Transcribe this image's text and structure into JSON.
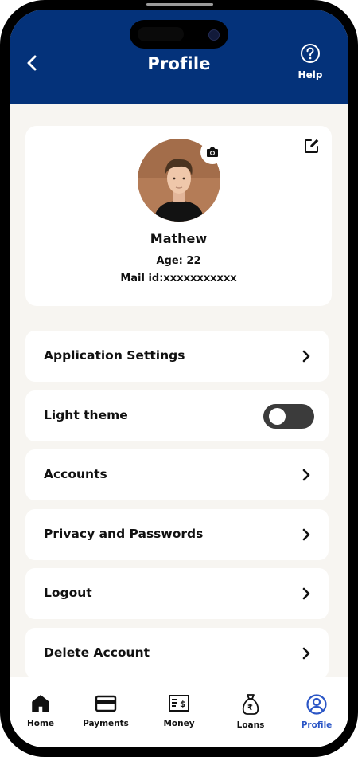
{
  "header": {
    "title": "Profile",
    "help_label": "Help",
    "background_color": "#04327a"
  },
  "profile": {
    "name": "Mathew",
    "age": "Age: 22",
    "mail": "Mail id:xxxxxxxxxxx"
  },
  "menu": [
    {
      "label": "Application Settings",
      "control": "chevron"
    },
    {
      "label": "Light theme",
      "control": "toggle",
      "toggle_on": false
    },
    {
      "label": "Accounts",
      "control": "chevron"
    },
    {
      "label": "Privacy and Passwords",
      "control": "chevron"
    },
    {
      "label": "Logout",
      "control": "chevron"
    },
    {
      "label": "Delete Account",
      "control": "chevron"
    }
  ],
  "tabs": [
    {
      "label": "Home",
      "icon": "home-icon",
      "active": false
    },
    {
      "label": "Payments",
      "icon": "card-icon",
      "active": false
    },
    {
      "label": "Money",
      "icon": "money-icon",
      "active": false
    },
    {
      "label": "Loans",
      "icon": "moneybag-icon",
      "active": false
    },
    {
      "label": "Profile",
      "icon": "profile-icon",
      "active": true
    }
  ],
  "colors": {
    "accent": "#2b56c6",
    "page_background": "#f7f5f1",
    "toggle_track": "#3b3b3b"
  }
}
